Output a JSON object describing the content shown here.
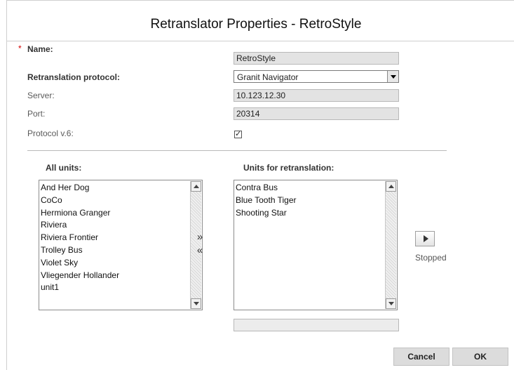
{
  "dialog": {
    "title": "Retranslator Properties - RetroStyle"
  },
  "form": {
    "required_marker": "*",
    "name_label": "Name:",
    "name_value": "RetroStyle",
    "protocol_label": "Retranslation protocol:",
    "protocol_value": "Granit Navigator",
    "server_label": "Server:",
    "server_value": "10.123.12.30",
    "port_label": "Port:",
    "port_value": "20314",
    "protocol_v6_label": "Protocol v.6:",
    "protocol_v6_checked": true,
    "protocol_v6_mark": "✓"
  },
  "units": {
    "all_header": "All units:",
    "all": [
      "And Her Dog",
      "CoCo",
      "Hermiona Granger",
      "Riviera",
      "Riviera Frontier",
      "Trolley Bus",
      "Violet Sky",
      "Vliegender Hollander",
      "unit1"
    ],
    "retranslation_header": "Units for retranslation:",
    "retranslation": [
      "Contra Bus",
      "Blue Tooth Tiger",
      "Shooting Star"
    ],
    "add_label": "»",
    "remove_label": "«"
  },
  "status": {
    "text": "Stopped",
    "progress_fraction": 0
  },
  "buttons": {
    "cancel": "Cancel",
    "ok": "OK"
  },
  "icons": {
    "play": "play-icon",
    "dropdown": "chevron-down-icon",
    "scroll_up": "scroll-up-arrow-icon",
    "scroll_down": "scroll-down-arrow-icon"
  },
  "colors": {
    "required": "#d40000",
    "field_bg": "#e3e3e3",
    "button_bg": "#dcdcdc"
  }
}
